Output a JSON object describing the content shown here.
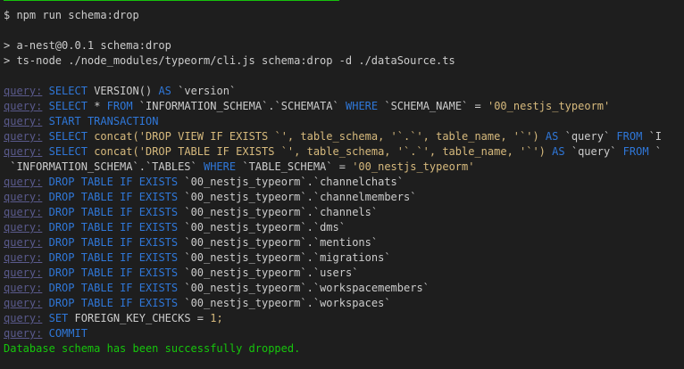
{
  "terminal": {
    "top_partial": "",
    "command": "$ npm run schema:drop",
    "script_header": "> a-nest@0.0.1 schema:drop",
    "script_cmd": "> ts-node ./node_modules/typeorm/cli.js schema:drop -d ./dataSource.ts",
    "query_label": "query:",
    "lines": {
      "l1": [
        "SELECT",
        "VERSION()",
        "AS",
        "`version`"
      ],
      "l2": [
        "SELECT",
        "*",
        "FROM",
        "`INFORMATION_SCHEMA`.`SCHEMATA`",
        "WHERE",
        "`SCHEMA_NAME`",
        "=",
        "'00_nestjs_typeorm'"
      ],
      "l3": [
        "START TRANSACTION"
      ],
      "l4": [
        "SELECT",
        "concat('DROP VIEW IF EXISTS `', table_schema, '`.`', table_name, '`')",
        "AS",
        "`query`",
        "FROM",
        "`I"
      ],
      "l5": [
        "SELECT",
        "concat('DROP TABLE IF EXISTS `', table_schema, '`.`', table_name, '`')",
        "AS",
        "`query`",
        "FROM",
        "`"
      ],
      "l5b": [
        "`INFORMATION_SCHEMA`.`TABLES`",
        "WHERE",
        "`TABLE_SCHEMA`",
        "=",
        "'00_nestjs_typeorm'"
      ],
      "drops": [
        "`00_nestjs_typeorm`.`channelchats`",
        "`00_nestjs_typeorm`.`channelmembers`",
        "`00_nestjs_typeorm`.`channels`",
        "`00_nestjs_typeorm`.`dms`",
        "`00_nestjs_typeorm`.`mentions`",
        "`00_nestjs_typeorm`.`migrations`",
        "`00_nestjs_typeorm`.`users`",
        "`00_nestjs_typeorm`.`workspacemembers`",
        "`00_nestjs_typeorm`.`workspaces`"
      ],
      "drop_kw1": "DROP TABLE",
      "drop_kw2": "IF",
      "drop_kw3": "EXISTS",
      "fk": [
        "SET",
        "FOREIGN_KEY_CHECKS",
        "=",
        "1;"
      ],
      "commit": "COMMIT"
    },
    "success_message": "Database schema has been successfully dropped."
  },
  "colors": {
    "background": "#1e1e1e",
    "keyword": "#2f77d8",
    "string": "#d7ba7d",
    "success": "#16c60c",
    "query_label": "#5a5a8c"
  }
}
